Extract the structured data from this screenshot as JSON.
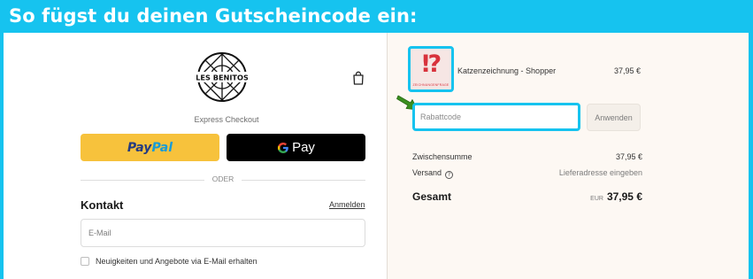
{
  "banner": {
    "title": "So fügst du deinen Gutscheincode ein:"
  },
  "checkout": {
    "brand": "LES BENITOS",
    "express_label": "Express Checkout",
    "paypal": {
      "part1": "Pay",
      "part2": "Pal"
    },
    "gpay": {
      "g": "G",
      "label": "Pay"
    },
    "divider_text": "ODER",
    "contact": {
      "title": "Kontakt",
      "login_link": "Anmelden",
      "email_placeholder": "E-Mail",
      "newsletter_label": "Neuigkeiten und Angebote via E-Mail erhalten"
    }
  },
  "summary": {
    "product": {
      "name": "Katzenzeichnung - Shopper",
      "price": "37,95 €",
      "thumb_mark": "⁉",
      "thumb_caption": "ZEICHNUNGENFRAGE"
    },
    "discount": {
      "placeholder": "Rabattcode",
      "apply_label": "Anwenden"
    },
    "subtotal": {
      "label": "Zwischensumme",
      "value": "37,95 €"
    },
    "shipping": {
      "label": "Versand",
      "info_icon": "?",
      "value": "Lieferadresse eingeben"
    },
    "total": {
      "label": "Gesamt",
      "currency": "EUR",
      "value": "37,95 €"
    }
  },
  "colors": {
    "accent": "#16c3ef",
    "paypal_yellow": "#f7c23c",
    "arrow_green": "#3a8f1f",
    "thumb_red": "#d8323c"
  },
  "icons": {
    "bag": "shopping-bag-icon",
    "arrow": "green-arrow-icon",
    "info": "info-icon"
  }
}
